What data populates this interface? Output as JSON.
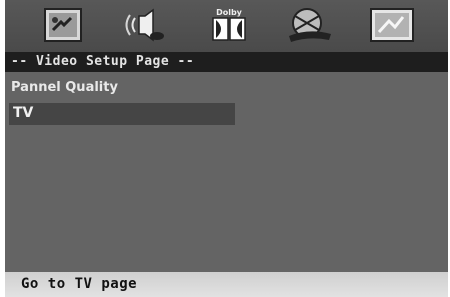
{
  "toolbar": {
    "icons": [
      "general-setup-icon",
      "speaker-setup-icon",
      "dolby-audio-icon",
      "video-setup-icon",
      "preference-setup-icon"
    ],
    "dolby_label": "Dolby"
  },
  "page_title": "-- Video Setup Page --",
  "menu": {
    "label": "Pannel Quality",
    "selected_option": "TV"
  },
  "status": "Go to TV page",
  "colors": {
    "background": "#646464",
    "title_bar": "#1e1e1e",
    "highlight": "#454545",
    "status_bar": "#d8d8d8"
  }
}
